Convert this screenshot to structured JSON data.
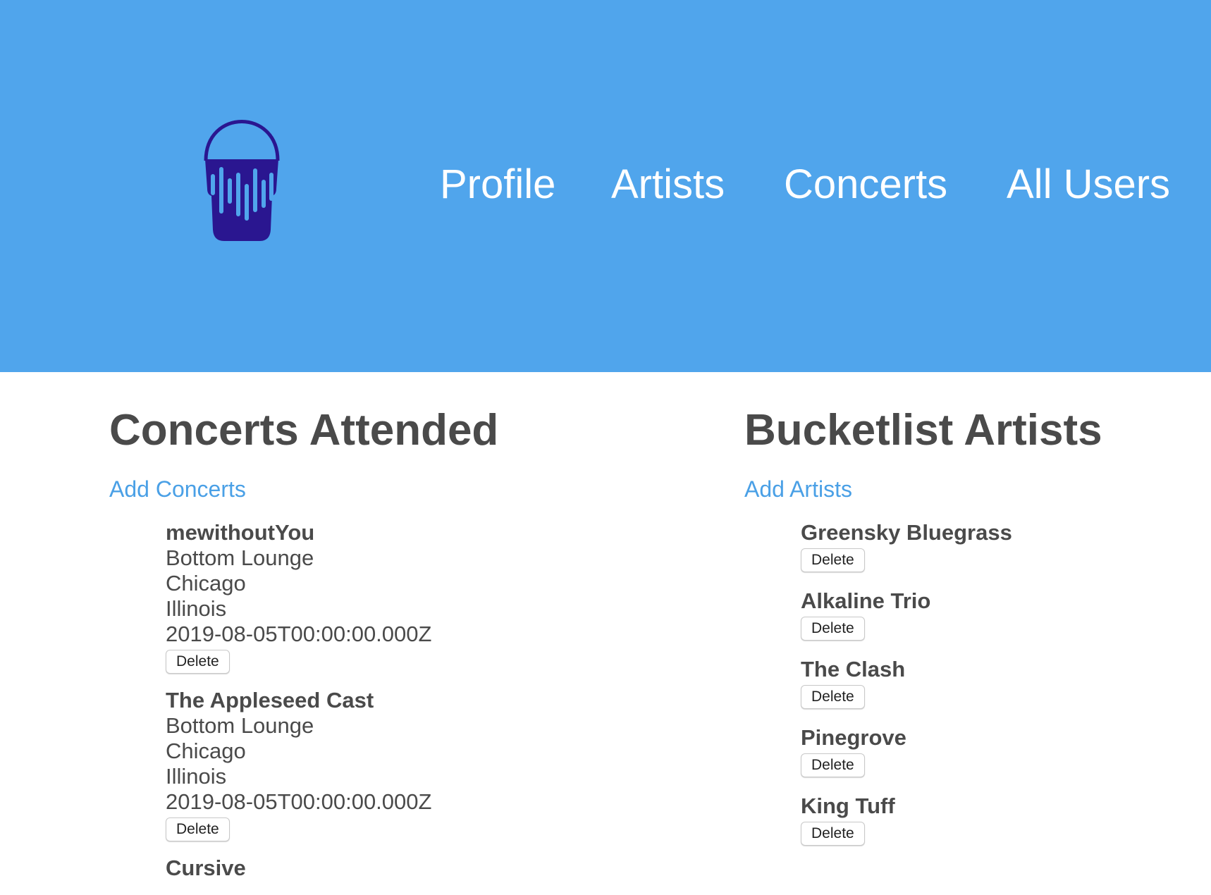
{
  "colors": {
    "header_bg": "#50a5ec",
    "logo": "#2a1690",
    "link": "#4aa0e6",
    "text": "#4a4a4a"
  },
  "logo": {
    "icon": "paint-bucket-soundwave-icon"
  },
  "nav": {
    "profile": "Profile",
    "artists": "Artists",
    "concerts": "Concerts",
    "all_users": "All Users"
  },
  "concerts_section": {
    "heading": "Concerts Attended",
    "add_link": "Add Concerts",
    "items": [
      {
        "artist": "mewithoutYou",
        "venue": "Bottom Lounge",
        "city": "Chicago",
        "state": "Illinois",
        "date": "2019-08-05T00:00:00.000Z",
        "delete_label": "Delete"
      },
      {
        "artist": "The Appleseed Cast",
        "venue": "Bottom Lounge",
        "city": "Chicago",
        "state": "Illinois",
        "date": "2019-08-05T00:00:00.000Z",
        "delete_label": "Delete"
      },
      {
        "artist": "Cursive"
      }
    ]
  },
  "artists_section": {
    "heading": "Bucketlist Artists",
    "add_link": "Add Artists",
    "items": [
      {
        "name": "Greensky Bluegrass",
        "delete_label": "Delete"
      },
      {
        "name": "Alkaline Trio",
        "delete_label": "Delete"
      },
      {
        "name": "The Clash",
        "delete_label": "Delete"
      },
      {
        "name": "Pinegrove",
        "delete_label": "Delete"
      },
      {
        "name": "King Tuff",
        "delete_label": "Delete"
      }
    ]
  }
}
